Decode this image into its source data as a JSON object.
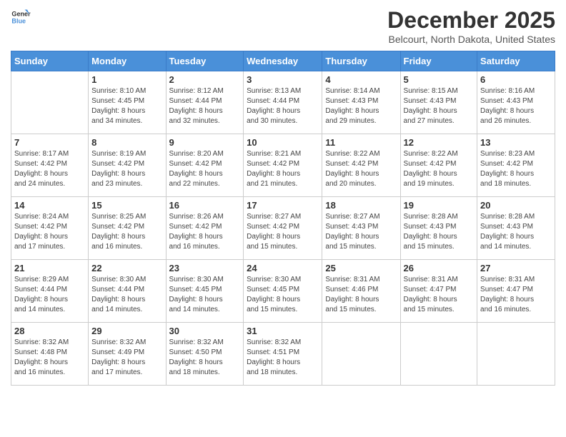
{
  "header": {
    "logo_general": "General",
    "logo_blue": "Blue",
    "title": "December 2025",
    "subtitle": "Belcourt, North Dakota, United States"
  },
  "days_of_week": [
    "Sunday",
    "Monday",
    "Tuesday",
    "Wednesday",
    "Thursday",
    "Friday",
    "Saturday"
  ],
  "weeks": [
    [
      {
        "day": "",
        "info": ""
      },
      {
        "day": "1",
        "info": "Sunrise: 8:10 AM\nSunset: 4:45 PM\nDaylight: 8 hours\nand 34 minutes."
      },
      {
        "day": "2",
        "info": "Sunrise: 8:12 AM\nSunset: 4:44 PM\nDaylight: 8 hours\nand 32 minutes."
      },
      {
        "day": "3",
        "info": "Sunrise: 8:13 AM\nSunset: 4:44 PM\nDaylight: 8 hours\nand 30 minutes."
      },
      {
        "day": "4",
        "info": "Sunrise: 8:14 AM\nSunset: 4:43 PM\nDaylight: 8 hours\nand 29 minutes."
      },
      {
        "day": "5",
        "info": "Sunrise: 8:15 AM\nSunset: 4:43 PM\nDaylight: 8 hours\nand 27 minutes."
      },
      {
        "day": "6",
        "info": "Sunrise: 8:16 AM\nSunset: 4:43 PM\nDaylight: 8 hours\nand 26 minutes."
      }
    ],
    [
      {
        "day": "7",
        "info": "Sunrise: 8:17 AM\nSunset: 4:42 PM\nDaylight: 8 hours\nand 24 minutes."
      },
      {
        "day": "8",
        "info": "Sunrise: 8:19 AM\nSunset: 4:42 PM\nDaylight: 8 hours\nand 23 minutes."
      },
      {
        "day": "9",
        "info": "Sunrise: 8:20 AM\nSunset: 4:42 PM\nDaylight: 8 hours\nand 22 minutes."
      },
      {
        "day": "10",
        "info": "Sunrise: 8:21 AM\nSunset: 4:42 PM\nDaylight: 8 hours\nand 21 minutes."
      },
      {
        "day": "11",
        "info": "Sunrise: 8:22 AM\nSunset: 4:42 PM\nDaylight: 8 hours\nand 20 minutes."
      },
      {
        "day": "12",
        "info": "Sunrise: 8:22 AM\nSunset: 4:42 PM\nDaylight: 8 hours\nand 19 minutes."
      },
      {
        "day": "13",
        "info": "Sunrise: 8:23 AM\nSunset: 4:42 PM\nDaylight: 8 hours\nand 18 minutes."
      }
    ],
    [
      {
        "day": "14",
        "info": "Sunrise: 8:24 AM\nSunset: 4:42 PM\nDaylight: 8 hours\nand 17 minutes."
      },
      {
        "day": "15",
        "info": "Sunrise: 8:25 AM\nSunset: 4:42 PM\nDaylight: 8 hours\nand 16 minutes."
      },
      {
        "day": "16",
        "info": "Sunrise: 8:26 AM\nSunset: 4:42 PM\nDaylight: 8 hours\nand 16 minutes."
      },
      {
        "day": "17",
        "info": "Sunrise: 8:27 AM\nSunset: 4:42 PM\nDaylight: 8 hours\nand 15 minutes."
      },
      {
        "day": "18",
        "info": "Sunrise: 8:27 AM\nSunset: 4:43 PM\nDaylight: 8 hours\nand 15 minutes."
      },
      {
        "day": "19",
        "info": "Sunrise: 8:28 AM\nSunset: 4:43 PM\nDaylight: 8 hours\nand 15 minutes."
      },
      {
        "day": "20",
        "info": "Sunrise: 8:28 AM\nSunset: 4:43 PM\nDaylight: 8 hours\nand 14 minutes."
      }
    ],
    [
      {
        "day": "21",
        "info": "Sunrise: 8:29 AM\nSunset: 4:44 PM\nDaylight: 8 hours\nand 14 minutes."
      },
      {
        "day": "22",
        "info": "Sunrise: 8:30 AM\nSunset: 4:44 PM\nDaylight: 8 hours\nand 14 minutes."
      },
      {
        "day": "23",
        "info": "Sunrise: 8:30 AM\nSunset: 4:45 PM\nDaylight: 8 hours\nand 14 minutes."
      },
      {
        "day": "24",
        "info": "Sunrise: 8:30 AM\nSunset: 4:45 PM\nDaylight: 8 hours\nand 15 minutes."
      },
      {
        "day": "25",
        "info": "Sunrise: 8:31 AM\nSunset: 4:46 PM\nDaylight: 8 hours\nand 15 minutes."
      },
      {
        "day": "26",
        "info": "Sunrise: 8:31 AM\nSunset: 4:47 PM\nDaylight: 8 hours\nand 15 minutes."
      },
      {
        "day": "27",
        "info": "Sunrise: 8:31 AM\nSunset: 4:47 PM\nDaylight: 8 hours\nand 16 minutes."
      }
    ],
    [
      {
        "day": "28",
        "info": "Sunrise: 8:32 AM\nSunset: 4:48 PM\nDaylight: 8 hours\nand 16 minutes."
      },
      {
        "day": "29",
        "info": "Sunrise: 8:32 AM\nSunset: 4:49 PM\nDaylight: 8 hours\nand 17 minutes."
      },
      {
        "day": "30",
        "info": "Sunrise: 8:32 AM\nSunset: 4:50 PM\nDaylight: 8 hours\nand 18 minutes."
      },
      {
        "day": "31",
        "info": "Sunrise: 8:32 AM\nSunset: 4:51 PM\nDaylight: 8 hours\nand 18 minutes."
      },
      {
        "day": "",
        "info": ""
      },
      {
        "day": "",
        "info": ""
      },
      {
        "day": "",
        "info": ""
      }
    ]
  ]
}
